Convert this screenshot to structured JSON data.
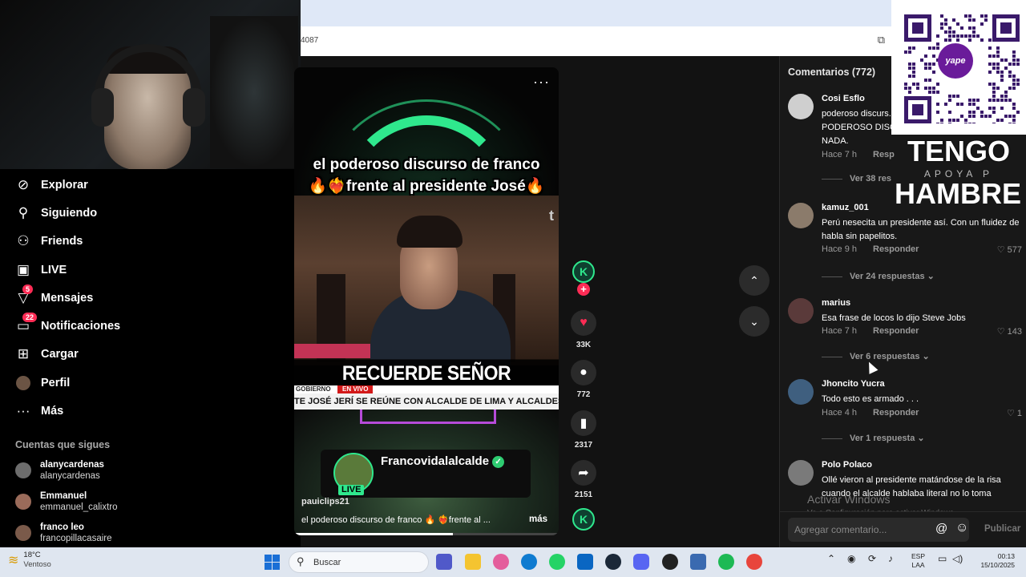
{
  "browser": {
    "url_fragment": "4087"
  },
  "sidebar": {
    "items": [
      {
        "label": "Explorar",
        "icon": "compass-icon"
      },
      {
        "label": "Siguiendo",
        "icon": "user-follow-icon"
      },
      {
        "label": "Friends",
        "icon": "friends-icon"
      },
      {
        "label": "LIVE",
        "icon": "live-icon"
      },
      {
        "label": "Mensajes",
        "icon": "message-icon",
        "badge": "5"
      },
      {
        "label": "Notificaciones",
        "icon": "inbox-icon",
        "badge": "22"
      },
      {
        "label": "Cargar",
        "icon": "upload-icon"
      },
      {
        "label": "Perfil",
        "icon": "profile-avatar-icon"
      },
      {
        "label": "Más",
        "icon": "more-dots-icon"
      }
    ],
    "following_title": "Cuentas que sigues",
    "following": [
      {
        "name": "alanycardenas",
        "username": "alanycardenas"
      },
      {
        "name": "Emmanuel",
        "username": "emmanuel_calixtro"
      },
      {
        "name": "franco leo",
        "username": "francopillacasaire"
      }
    ]
  },
  "video": {
    "title_line1": "el poderoso discurso de franco",
    "title_line2": "🔥❤️‍🔥frente al presidente José🔥",
    "side_letter": "t",
    "banner": "RECUERDE SEÑOR PRESIDENTE",
    "gobierno_label": "GOBIERNO",
    "envivo_label": "EN VIVO",
    "ticker": "TE JOSÉ JERÍ SE REÚNE CON ALCALDE DE LIMA Y ALCALDES D",
    "live_name": "Francovidalalcalde",
    "live_tag": "LIVE",
    "verified_mark": "✓",
    "author": "pauiclips21",
    "caption": "el poderoso discurso de franco 🔥 ❤️‍🔥frente al ...",
    "more": "más",
    "menu": "···",
    "progress": 0.6
  },
  "actions": {
    "creator_initial": "K",
    "plus": "+",
    "likes": "33K",
    "comments": "772",
    "saves": "2317",
    "shares": "2151",
    "music_initial": "K"
  },
  "nav_arrows": {
    "up": "⌃",
    "down": "⌄"
  },
  "comments_panel": {
    "header": "Comentarios (772)",
    "items": [
      {
        "name": "Cosi Esflo",
        "text": "poderoso discurs... PODEROSO DISC... NADA.",
        "time": "Hace 7 h",
        "reply": "Resp",
        "likes": "",
        "more": "Ver 38 res"
      },
      {
        "name": "kamuz_001",
        "text": "Perú nesecita un presidente así. Con un fluidez de habla sin papelitos.",
        "time": "Hace 9 h",
        "reply": "Responder",
        "likes": "577",
        "more": "Ver 24 respuestas ⌄"
      },
      {
        "name": "marius",
        "text": "Esa frase de locos lo dijo Steve Jobs",
        "time": "Hace 7 h",
        "reply": "Responder",
        "likes": "143",
        "more": "Ver 6 respuestas ⌄"
      },
      {
        "name": "Jhoncito Yucra",
        "text": "Todo esto es armado . . .",
        "time": "Hace 4 h",
        "reply": "Responder",
        "likes": "1",
        "more": "Ver 1 respuesta ⌄"
      },
      {
        "name": "Polo Polaco",
        "text": "Ollé vieron al presidente matándose de la risa cuando el alcalde hablaba literal no lo toma",
        "time": "",
        "reply": "",
        "likes": "",
        "more": ""
      }
    ],
    "watermark_title": "Activar Windows",
    "watermark_sub": "Ve a Configuración para activar Windows.",
    "input_placeholder": "Agregar comentario...",
    "at": "@",
    "emoji": "☺",
    "publish": "Publicar"
  },
  "overlay": {
    "qr_logo": "yape",
    "tengo": "TENGO",
    "apoya": "APOYA P",
    "hambre": "HAMBRE"
  },
  "taskbar": {
    "temp": "18°C",
    "weather": "Ventoso",
    "search": "Buscar",
    "lang1": "ESP",
    "lang2": "LAA",
    "time": "00:13",
    "date": "15/10/2025"
  },
  "colors": {
    "accent": "#fe2c55",
    "live_green": "#2fe88d"
  }
}
